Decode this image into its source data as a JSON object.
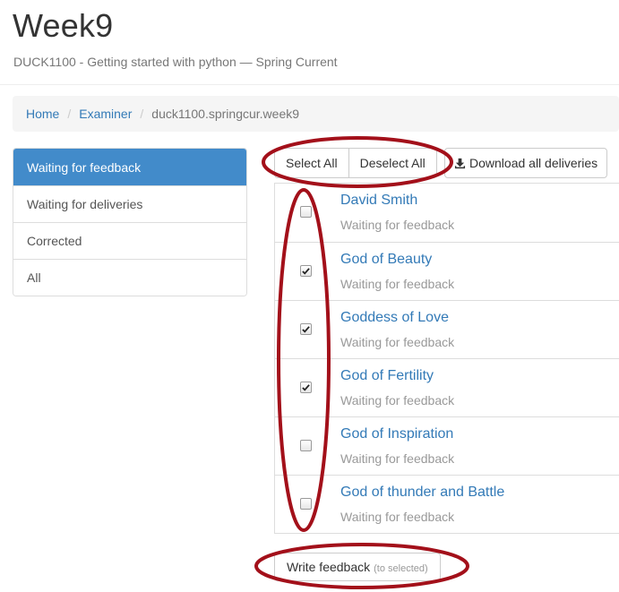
{
  "header": {
    "title": "Week9",
    "subtitle": "DUCK1100 - Getting started with python — Spring Current"
  },
  "breadcrumb": {
    "items": [
      "Home",
      "Examiner"
    ],
    "current": "duck1100.springcur.week9",
    "separator": "/"
  },
  "sidebar": {
    "items": [
      {
        "label": "Waiting for feedback",
        "active": true
      },
      {
        "label": "Waiting for deliveries",
        "active": false
      },
      {
        "label": "Corrected",
        "active": false
      },
      {
        "label": "All",
        "active": false
      }
    ]
  },
  "toolbar": {
    "select_all": "Select All",
    "deselect_all": "Deselect All",
    "download_all": "Download all deliveries",
    "download_icon": "download-icon"
  },
  "deliveries": [
    {
      "name": "David Smith",
      "status": "Waiting for feedback",
      "checked": false
    },
    {
      "name": "God of Beauty",
      "status": "Waiting for feedback",
      "checked": true
    },
    {
      "name": "Goddess of Love",
      "status": "Waiting for feedback",
      "checked": true
    },
    {
      "name": "God of Fertility",
      "status": "Waiting for feedback",
      "checked": true
    },
    {
      "name": "God of Inspiration",
      "status": "Waiting for feedback",
      "checked": false
    },
    {
      "name": "God of thunder and Battle",
      "status": "Waiting for feedback",
      "checked": false
    }
  ],
  "write_feedback": {
    "label": "Write feedback",
    "hint": "(to selected)"
  },
  "colors": {
    "accent": "#428bca",
    "link": "#337ab7",
    "annotation": "#a3101a"
  }
}
